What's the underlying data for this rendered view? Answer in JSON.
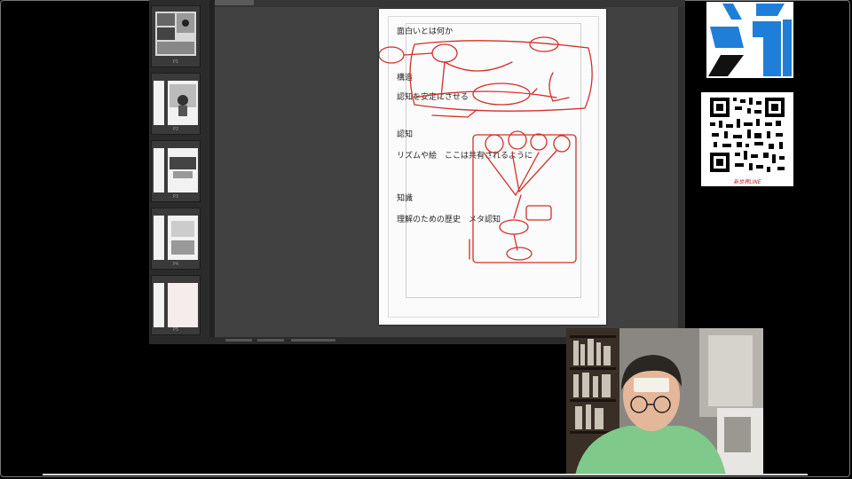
{
  "manuscript": {
    "lines": [
      "面白いとは何か",
      "構造",
      "認知を安定にさせる",
      "認知",
      "リズムや絵　ここは共有されるように",
      "知識",
      "理解のための歴史　メタ認知"
    ]
  },
  "sidebar": {
    "pages": [
      {
        "label": "P1"
      },
      {
        "label": "P2"
      },
      {
        "label": "P3"
      },
      {
        "label": "P4"
      },
      {
        "label": "P5"
      }
    ]
  },
  "colors": {
    "sketch_red": "#d0302a",
    "logo_blue": "#1f7fd8",
    "app_gray": "#414141"
  },
  "qr": {
    "caption": "新世界LINE"
  }
}
